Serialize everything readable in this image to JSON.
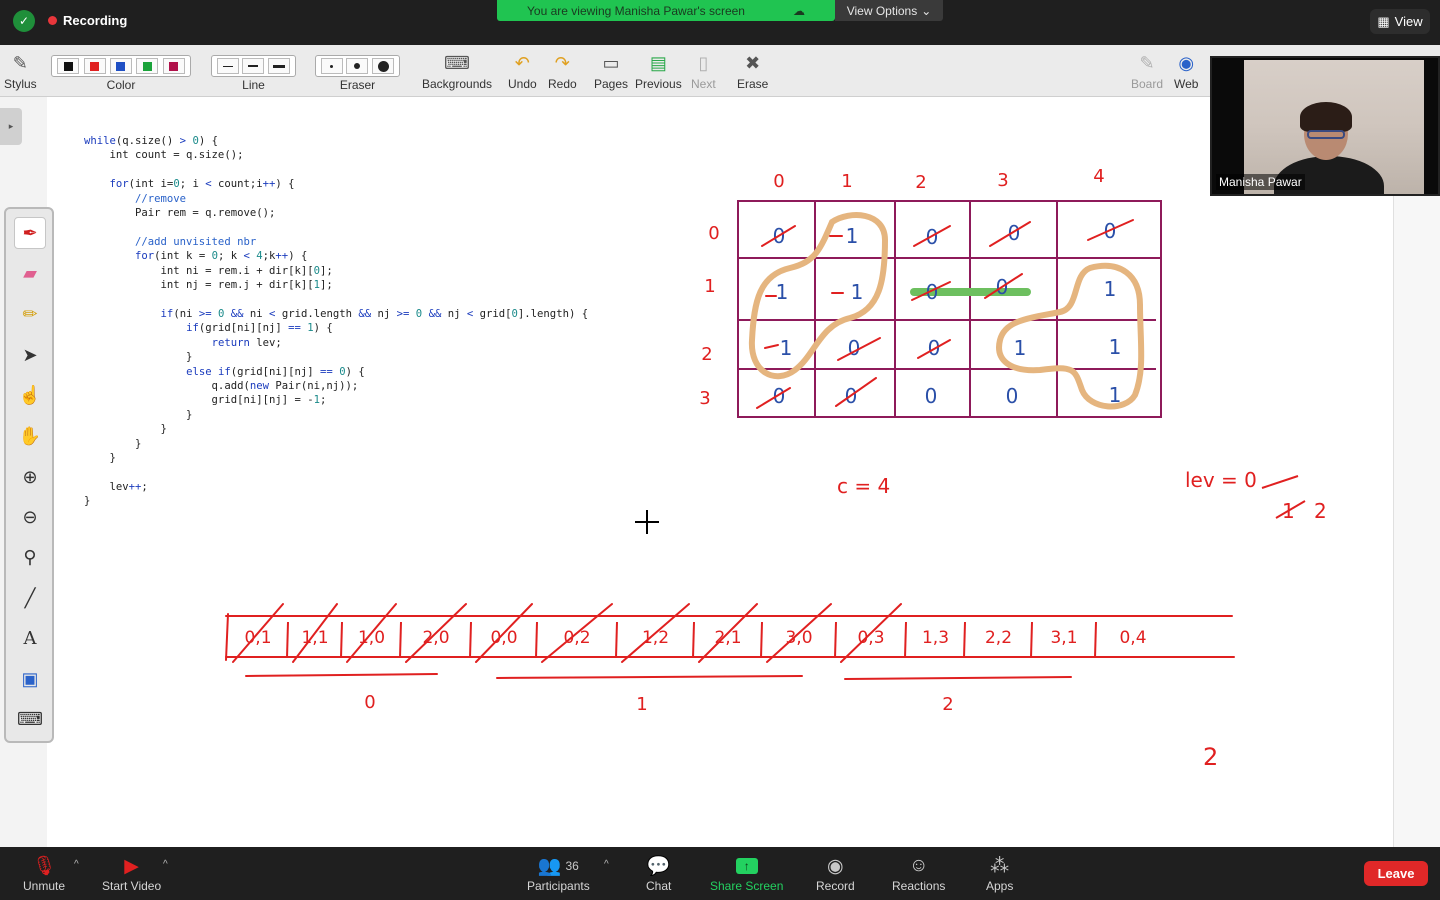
{
  "topbar": {
    "recording_label": "Recording",
    "viewing_banner": "You are viewing Manisha Pawar's screen",
    "view_options_label": "View Options",
    "view_label": "View"
  },
  "annotation_toolbar": {
    "stylus": "Stylus",
    "color": "Color",
    "line": "Line",
    "eraser": "Eraser",
    "backgrounds": "Backgrounds",
    "undo": "Undo",
    "redo": "Redo",
    "pages": "Pages",
    "previous": "Previous",
    "next": "Next",
    "erase": "Erase",
    "board": "Board",
    "web": "Web",
    "colors": [
      "#111111",
      "#e02020",
      "#1f4fc4",
      "#1aa33a",
      "#b0104a"
    ]
  },
  "code_lines": [
    "while(q.size() > 0) {",
    "    int count = q.size();",
    "",
    "    for(int i=0; i < count;i++) {",
    "        //remove",
    "        Pair rem = q.remove();",
    "",
    "        //add unvisited nbr",
    "        for(int k = 0; k < 4;k++) {",
    "            int ni = rem.i + dir[k][0];",
    "            int nj = rem.j + dir[k][1];",
    "",
    "            if(ni >= 0 && ni < grid.length && nj >= 0 && nj < grid[0].length) {",
    "                if(grid[ni][nj] == 1) {",
    "                    return lev;",
    "                }",
    "                else if(grid[ni][nj] == 0) {",
    "                    q.add(new Pair(ni,nj));",
    "                    grid[ni][nj] = -1;",
    "                }",
    "            }",
    "        }",
    "    }",
    "",
    "    lev++;",
    "}"
  ],
  "whiteboard": {
    "col_headers": [
      "0",
      "1",
      "2",
      "3",
      "4"
    ],
    "row_headers": [
      "0",
      "1",
      "2",
      "3"
    ],
    "grid": [
      [
        "0",
        "1",
        "0",
        "0",
        "0"
      ],
      [
        "1",
        "1",
        "0",
        "0",
        "1"
      ],
      [
        "1",
        "0",
        "0",
        "1",
        "1"
      ],
      [
        "0",
        "0",
        "0",
        "0",
        "1"
      ]
    ],
    "count_note": "c = 4",
    "level_note": "lev = 0",
    "level_values": [
      "1",
      "2"
    ],
    "queue_cells": [
      "0,1",
      "1,1",
      "1,0",
      "2,0",
      "0,0",
      "0,2",
      "1,2",
      "2,1",
      "3,0",
      "0,3",
      "1,3",
      "2,2",
      "3,1",
      "0,4"
    ],
    "queue_group_labels": [
      "0",
      "1",
      "2"
    ],
    "answer": "2"
  },
  "video": {
    "participant_name": "Manisha Pawar"
  },
  "bottombar": {
    "unmute": "Unmute",
    "start_video": "Start Video",
    "participants": "Participants",
    "participant_count": "36",
    "chat": "Chat",
    "share_screen": "Share Screen",
    "record": "Record",
    "reactions": "Reactions",
    "apps": "Apps",
    "leave": "Leave"
  }
}
